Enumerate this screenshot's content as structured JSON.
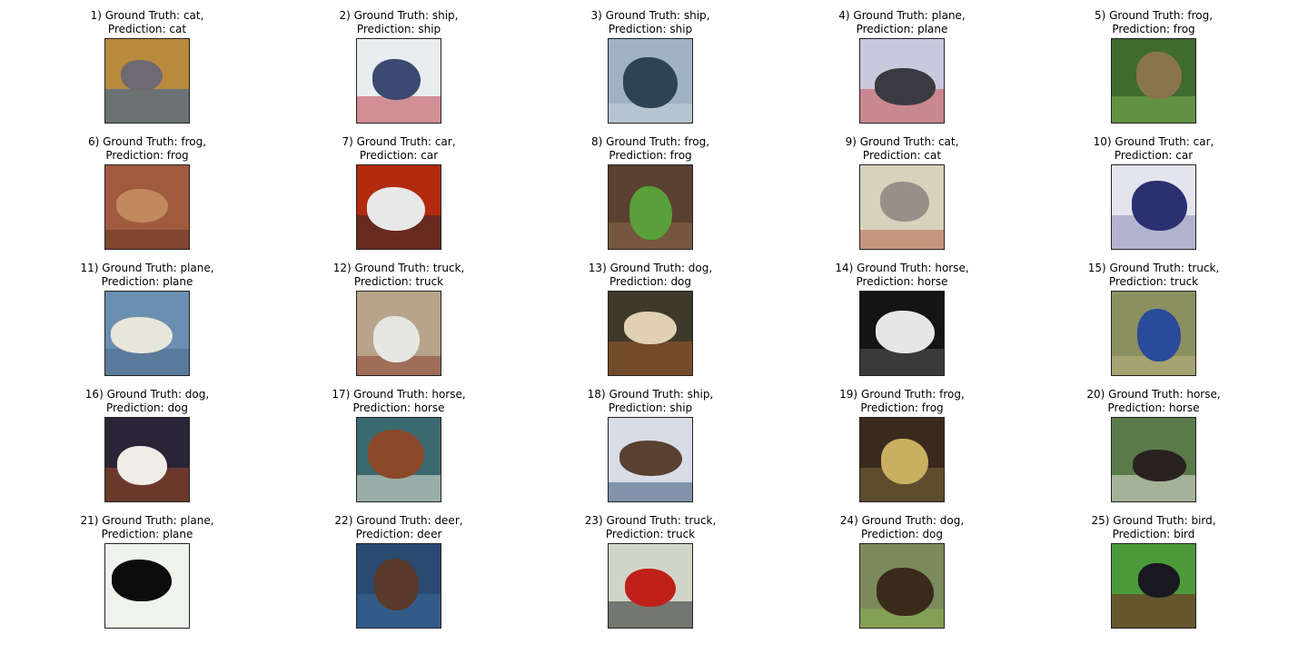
{
  "figure": {
    "items": [
      {
        "number": "1)",
        "gt_label": "Ground Truth: cat,",
        "pred_label": "Prediction: cat",
        "gt": "cat",
        "pred": "cat",
        "colors": {
          "bg": "#b88a3c",
          "main": "#6e6a72",
          "accent": "#2c5fa0"
        }
      },
      {
        "number": "2)",
        "gt_label": "Ground Truth: ship,",
        "pred_label": "Prediction: ship",
        "gt": "ship",
        "pred": "ship",
        "colors": {
          "bg": "#e8edf0",
          "main": "#3a4a70",
          "accent": "#c0404a"
        }
      },
      {
        "number": "3)",
        "gt_label": "Ground Truth: ship,",
        "pred_label": "Prediction: ship",
        "gt": "ship",
        "pred": "ship",
        "colors": {
          "bg": "#9fb3c4",
          "main": "#2d4457",
          "accent": "#c8d2dc"
        }
      },
      {
        "number": "4)",
        "gt_label": "Ground Truth: plane,",
        "pred_label": "Prediction: plane",
        "gt": "plane",
        "pred": "plane",
        "colors": {
          "bg": "#c9c9dd",
          "main": "#3a3a40",
          "accent": "#c85050"
        }
      },
      {
        "number": "5)",
        "gt_label": "Ground Truth: frog,",
        "pred_label": "Prediction: frog",
        "gt": "frog",
        "pred": "frog",
        "colors": {
          "bg": "#3f6a30",
          "main": "#8a7450",
          "accent": "#7fb055"
        }
      },
      {
        "number": "6)",
        "gt_label": "Ground Truth: frog,",
        "pred_label": "Prediction: frog",
        "gt": "frog",
        "pred": "frog",
        "colors": {
          "bg": "#a05a3e",
          "main": "#c08a5c",
          "accent": "#6a3424"
        }
      },
      {
        "number": "7)",
        "gt_label": "Ground Truth: car,",
        "pred_label": "Prediction: car",
        "gt": "car",
        "pred": "car",
        "colors": {
          "bg": "#b22a10",
          "main": "#e8e8e8",
          "accent": "#2a2a2a"
        }
      },
      {
        "number": "8)",
        "gt_label": "Ground Truth: frog,",
        "pred_label": "Prediction: frog",
        "gt": "frog",
        "pred": "frog",
        "colors": {
          "bg": "#5a4030",
          "main": "#5aa03a",
          "accent": "#8c6a4a"
        }
      },
      {
        "number": "9)",
        "gt_label": "Ground Truth: cat,",
        "pred_label": "Prediction: cat",
        "gt": "cat",
        "pred": "cat",
        "colors": {
          "bg": "#d9d2bc",
          "main": "#9a8f88",
          "accent": "#b5654a"
        }
      },
      {
        "number": "10)",
        "gt_label": "Ground Truth: car,",
        "pred_label": "Prediction: car",
        "gt": "car",
        "pred": "car",
        "colors": {
          "bg": "#e4e4ee",
          "main": "#2a3070",
          "accent": "#8a8ab8"
        }
      },
      {
        "number": "11)",
        "gt_label": "Ground Truth: plane,",
        "pred_label": "Prediction: plane",
        "gt": "plane",
        "pred": "plane",
        "colors": {
          "bg": "#6a8fb0",
          "main": "#e8e6dc",
          "accent": "#4c6a8a"
        }
      },
      {
        "number": "12)",
        "gt_label": "Ground Truth: truck,",
        "pred_label": "Prediction: truck",
        "gt": "truck",
        "pred": "truck",
        "colors": {
          "bg": "#b8a48a",
          "main": "#e6e6e2",
          "accent": "#8a4030"
        }
      },
      {
        "number": "13)",
        "gt_label": "Ground Truth: dog,",
        "pred_label": "Prediction: dog",
        "gt": "dog",
        "pred": "dog",
        "colors": {
          "bg": "#3e3a2a",
          "main": "#e0d0b4",
          "accent": "#a05a28"
        }
      },
      {
        "number": "14)",
        "gt_label": "Ground Truth: horse,",
        "pred_label": "Prediction: horse",
        "gt": "horse",
        "pred": "horse",
        "colors": {
          "bg": "#141414",
          "main": "#e6e6e6",
          "accent": "#5a5a5a"
        }
      },
      {
        "number": "15)",
        "gt_label": "Ground Truth: truck,",
        "pred_label": "Prediction: truck",
        "gt": "truck",
        "pred": "truck",
        "colors": {
          "bg": "#8a9060",
          "main": "#2a4a9a",
          "accent": "#c0b080"
        }
      },
      {
        "number": "16)",
        "gt_label": "Ground Truth: dog,",
        "pred_label": "Prediction: dog",
        "gt": "dog",
        "pred": "dog",
        "colors": {
          "bg": "#2a2438",
          "main": "#f0ece6",
          "accent": "#a04a20"
        }
      },
      {
        "number": "17)",
        "gt_label": "Ground Truth: horse,",
        "pred_label": "Prediction: horse",
        "gt": "horse",
        "pred": "horse",
        "colors": {
          "bg": "#3a6a70",
          "main": "#8a4a2a",
          "accent": "#e8e4d8"
        }
      },
      {
        "number": "18)",
        "gt_label": "Ground Truth: ship,",
        "pred_label": "Prediction: ship",
        "gt": "ship",
        "pred": "ship",
        "colors": {
          "bg": "#d8dce6",
          "main": "#5a4030",
          "accent": "#3a5a7a"
        }
      },
      {
        "number": "19)",
        "gt_label": "Ground Truth: frog,",
        "pred_label": "Prediction: frog",
        "gt": "frog",
        "pred": "frog",
        "colors": {
          "bg": "#3a2a1e",
          "main": "#c8b060",
          "accent": "#7a6a3a"
        }
      },
      {
        "number": "20)",
        "gt_label": "Ground Truth: horse,",
        "pred_label": "Prediction: horse",
        "gt": "horse",
        "pred": "horse",
        "colors": {
          "bg": "#5a7a4a",
          "main": "#2a2220",
          "accent": "#e0e0d8"
        }
      },
      {
        "number": "21)",
        "gt_label": "Ground Truth: plane,",
        "pred_label": "Prediction: plane",
        "gt": "plane",
        "pred": "plane",
        "colors": {
          "bg": "#eef4ec",
          "main": "#0c0c0c",
          "accent": "#eef4ec"
        }
      },
      {
        "number": "22)",
        "gt_label": "Ground Truth: deer,",
        "pred_label": "Prediction: deer",
        "gt": "deer",
        "pred": "deer",
        "colors": {
          "bg": "#2a4a70",
          "main": "#5a3a2a",
          "accent": "#3a6a9a"
        }
      },
      {
        "number": "23)",
        "gt_label": "Ground Truth: truck,",
        "pred_label": "Prediction: truck",
        "gt": "truck",
        "pred": "truck",
        "colors": {
          "bg": "#cfd6c8",
          "main": "#c0201a",
          "accent": "#2a2a2a"
        }
      },
      {
        "number": "24)",
        "gt_label": "Ground Truth: dog,",
        "pred_label": "Prediction: dog",
        "gt": "dog",
        "pred": "dog",
        "colors": {
          "bg": "#7a8a5a",
          "main": "#3a2a1a",
          "accent": "#8ab050"
        }
      },
      {
        "number": "25)",
        "gt_label": "Ground Truth: bird,",
        "pred_label": "Prediction: bird",
        "gt": "bird",
        "pred": "bird",
        "colors": {
          "bg": "#4a9a3a",
          "main": "#1a1820",
          "accent": "#7a2020"
        }
      }
    ]
  }
}
